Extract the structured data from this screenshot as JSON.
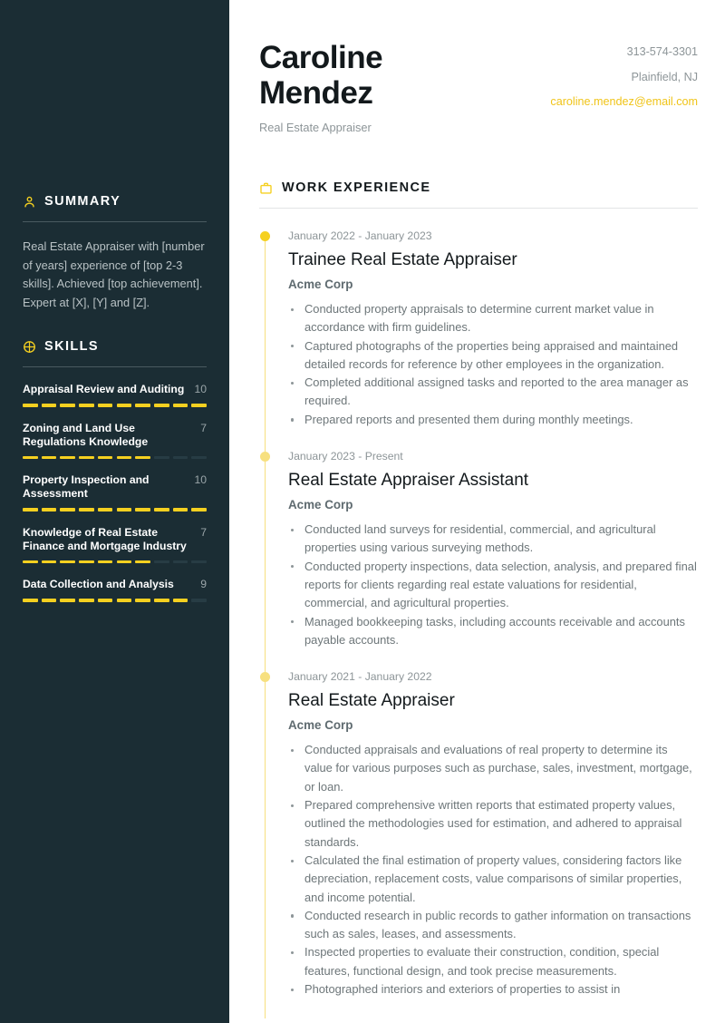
{
  "accent_color": "#f5d020",
  "sidebar_color": "#1b2d34",
  "header": {
    "name": "Caroline Mendez",
    "role": "Real Estate Appraiser",
    "phone": "313-574-3301",
    "location": "Plainfield, NJ",
    "email": "caroline.mendez@email.com"
  },
  "sidebar": {
    "summary": {
      "icon": "user-icon",
      "title": "SUMMARY",
      "text": "Real Estate Appraiser with [number of years] experience of [top 2-3 skills]. Achieved [top achievement]. Expert at [X], [Y] and [Z]."
    },
    "skills": {
      "icon": "skills-chart-icon",
      "title": "SKILLS",
      "max": 10,
      "items": [
        {
          "name": "Appraisal Review and Auditing",
          "score": 10
        },
        {
          "name": "Zoning and Land Use Regulations Knowledge",
          "score": 7
        },
        {
          "name": "Property Inspection and Assessment",
          "score": 10
        },
        {
          "name": "Knowledge of Real Estate Finance and Mortgage Industry",
          "score": 7
        },
        {
          "name": "Data Collection and Analysis",
          "score": 9
        }
      ]
    }
  },
  "work_experience": {
    "icon": "briefcase-icon",
    "title": "WORK EXPERIENCE",
    "jobs": [
      {
        "date": "January 2022 - January 2023",
        "title": "Trainee Real Estate Appraiser",
        "company": "Acme Corp",
        "bullets": [
          "Conducted property appraisals to determine current market value in accordance with firm guidelines.",
          "Captured photographs of the properties being appraised and maintained detailed records for reference by other employees in the organization.",
          "Completed additional assigned tasks and reported to the area manager as required.",
          "Prepared reports and presented them during monthly meetings."
        ]
      },
      {
        "date": "January 2023 - Present",
        "title": "Real Estate Appraiser Assistant",
        "company": "Acme Corp",
        "bullets": [
          "Conducted land surveys for residential, commercial, and agricultural properties using various surveying methods.",
          "Conducted property inspections, data selection, analysis, and prepared final reports for clients regarding real estate valuations for residential, commercial, and agricultural properties.",
          "Managed bookkeeping tasks, including accounts receivable and accounts payable accounts."
        ]
      },
      {
        "date": "January 2021 - January 2022",
        "title": "Real Estate Appraiser",
        "company": "Acme Corp",
        "bullets": [
          "Conducted appraisals and evaluations of real property to determine its value for various purposes such as purchase, sales, investment, mortgage, or loan.",
          "Prepared comprehensive written reports that estimated property values, outlined the methodologies used for estimation, and adhered to appraisal standards.",
          "Calculated the final estimation of property values, considering factors like depreciation, replacement costs, value comparisons of similar properties, and income potential.",
          "Conducted research in public records to gather information on transactions such as sales, leases, and assessments.",
          "Inspected properties to evaluate their construction, condition, special features, functional design, and took precise measurements.",
          "Photographed interiors and exteriors of properties to assist in"
        ]
      }
    ]
  }
}
